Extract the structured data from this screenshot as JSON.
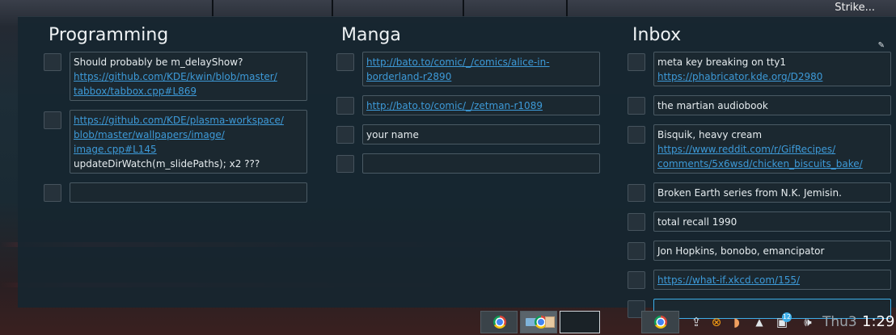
{
  "desktop": {
    "top_right_label": "Strike..."
  },
  "columns": [
    {
      "title": "Programming",
      "items": [
        {
          "lines": [
            {
              "text": "Should probably be m_delayShow?",
              "link": false
            },
            {
              "text": "https://github.com/KDE/kwin/blob/master/",
              "link": true
            },
            {
              "text": "tabbox/tabbox.cpp#L869",
              "link": true
            }
          ]
        },
        {
          "lines": [
            {
              "text": "https://github.com/KDE/plasma-workspace/",
              "link": true
            },
            {
              "text": "blob/master/wallpapers/image/",
              "link": true
            },
            {
              "text": "image.cpp#L145",
              "link": true
            },
            {
              "text": "updateDirWatch(m_slidePaths); x2 ???",
              "link": false
            }
          ]
        },
        {
          "lines": []
        }
      ]
    },
    {
      "title": "Manga",
      "items": [
        {
          "lines": [
            {
              "text": "http://bato.to/comic/_/comics/alice-in-",
              "link": true
            },
            {
              "text": "borderland-r2890",
              "link": true
            }
          ]
        },
        {
          "lines": [
            {
              "text": "http://bato.to/comic/_/zetman-r1089",
              "link": true
            }
          ]
        },
        {
          "lines": [
            {
              "text": "your name",
              "link": false
            }
          ]
        },
        {
          "lines": []
        }
      ]
    },
    {
      "title": "Inbox",
      "items": [
        {
          "lines": [
            {
              "text": "meta key breaking on tty1",
              "link": false
            },
            {
              "text": "https://phabricator.kde.org/D2980",
              "link": true
            }
          ]
        },
        {
          "lines": [
            {
              "text": "the martian audiobook",
              "link": false
            }
          ]
        },
        {
          "lines": [
            {
              "text": "Bisquik, heavy cream",
              "link": false
            },
            {
              "text": "https://www.reddit.com/r/GifRecipes/",
              "link": true
            },
            {
              "text": "comments/5x6wsd/chicken_biscuits_bake/",
              "link": true
            }
          ]
        },
        {
          "lines": [
            {
              "text": "Broken Earth series from N.K. Jemisin.",
              "link": false
            }
          ]
        },
        {
          "lines": [
            {
              "text": "total recall 1990",
              "link": false
            }
          ]
        },
        {
          "lines": [
            {
              "text": "Jon Hopkins, bonobo, emancipator",
              "link": false
            }
          ]
        },
        {
          "lines": [
            {
              "text": "https://what-if.xkcd.com/155/",
              "link": true
            }
          ]
        },
        {
          "lines": [],
          "focused": true
        }
      ]
    }
  ],
  "taskbar": {
    "tasks": [
      {
        "icon": "chrome-icon",
        "active": false
      },
      {
        "icon": "chrome-window-icon",
        "active": false
      },
      {
        "icon": "blank-window",
        "active": true
      },
      {
        "icon": "chrome-icon",
        "active": false
      }
    ],
    "tray": {
      "notification_count": "12",
      "clock_day": "Thu3",
      "clock_time": "1:29"
    }
  }
}
